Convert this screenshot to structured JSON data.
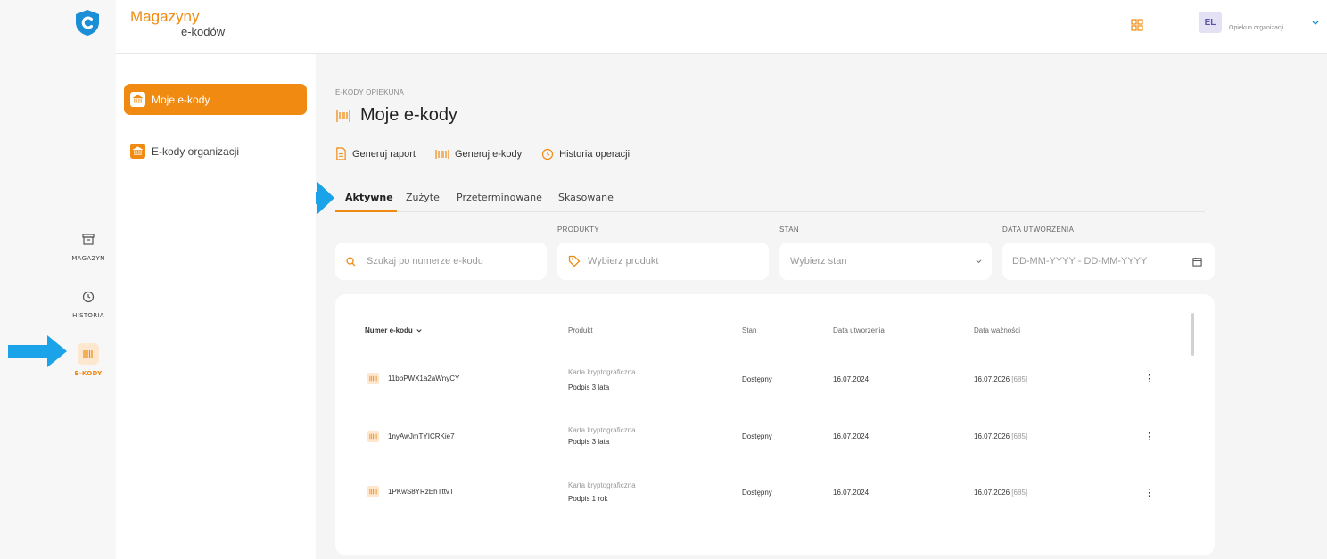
{
  "rail": {
    "items": [
      {
        "label": "MAGAZYN",
        "icon": "archive-icon"
      },
      {
        "label": "HISTORIA",
        "icon": "history-icon"
      },
      {
        "label": "E-KODY",
        "icon": "barcode-icon"
      }
    ]
  },
  "header": {
    "brand_line1": "Magazyny",
    "brand_line2": "e-kodów",
    "avatar_initials": "EL",
    "role": "Opiekun organizacji"
  },
  "subnav": {
    "items": [
      {
        "label": "Moje e-kody",
        "icon": "bank-icon"
      },
      {
        "label": "E-kody organizacji",
        "icon": "bank-icon"
      }
    ]
  },
  "main": {
    "breadcrumb": "E-KODY OPIEKUNA",
    "title": "Moje e-kody",
    "actions": [
      {
        "label": "Generuj raport",
        "icon": "document-icon"
      },
      {
        "label": "Generuj e-kody",
        "icon": "barcode-icon"
      },
      {
        "label": "Historia operacji",
        "icon": "history-icon"
      }
    ],
    "tabs": [
      "Aktywne",
      "Zużyte",
      "Przeterminowane",
      "Skasowane"
    ],
    "filters": {
      "search_placeholder": "Szukaj po numerze e-kodu",
      "product_label": "PRODUKTY",
      "product_placeholder": "Wybierz produkt",
      "state_label": "STAN",
      "state_placeholder": "Wybierz stan",
      "date_label": "DATA UTWORZENIA",
      "date_placeholder": "DD-MM-YYYY - DD-MM-YYYY"
    },
    "table": {
      "columns": [
        "Numer e-kodu",
        "Produkt",
        "Stan",
        "Data utworzenia",
        "Data ważności"
      ],
      "rows": [
        {
          "code": "11bbPWX1a2aWnyCY",
          "product_type": "Karta kryptograficzna",
          "product_name": "Podpis 3 lata",
          "state": "Dostępny",
          "created": "16.07.2024",
          "expires": "16.07.2026",
          "days": "[685]"
        },
        {
          "code": "1nyAwJmTYICRKie7",
          "product_type": "Karta kryptograficzna",
          "product_name": "Podpis 3 lata",
          "state": "Dostępny",
          "created": "16.07.2024",
          "expires": "16.07.2026",
          "days": "[685]"
        },
        {
          "code": "1PKwS8YRzEhTttvT",
          "product_type": "Karta kryptograficzna",
          "product_name": "Podpis 1 rok",
          "state": "Dostępny",
          "created": "16.07.2024",
          "expires": "16.07.2026",
          "days": "[685]"
        }
      ]
    }
  },
  "colors": {
    "accent": "#f08a10",
    "arrow": "#1aa3e8",
    "shield": "#1a8fd6"
  }
}
